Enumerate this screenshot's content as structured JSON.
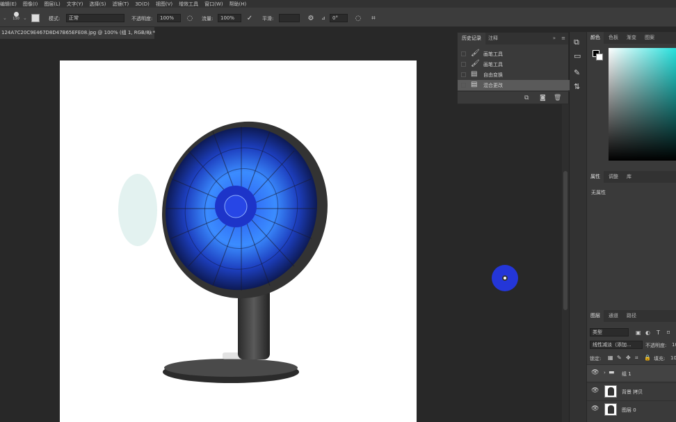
{
  "menu": [
    "编辑(E)",
    "图像(I)",
    "图层(L)",
    "文字(Y)",
    "选择(S)",
    "滤镜(T)",
    "3D(D)",
    "视图(V)",
    "增效工具",
    "窗口(W)",
    "帮助(H)"
  ],
  "options": {
    "brush_size": "130",
    "mode_label": "模式:",
    "mode_value": "正常",
    "opacity_label": "不透明度:",
    "opacity_value": "100%",
    "flow_label": "流量:",
    "flow_value": "100%",
    "smoothing_label": "平滑:",
    "angle_value": "0°"
  },
  "document": {
    "tab_title": "124A7C20C9E467D8D47B65EFE08.jpg @ 100% (组 1, RGB/8) *",
    "close": "×"
  },
  "history_panel": {
    "tabs": [
      "历史记录",
      "注释"
    ],
    "items": [
      {
        "icon": "brush-icon",
        "glyph": "🖌",
        "label": "画笔工具",
        "selected": false
      },
      {
        "icon": "brush-icon",
        "glyph": "🖌",
        "label": "画笔工具",
        "selected": false
      },
      {
        "icon": "document-icon",
        "glyph": "▤",
        "label": "自由变换",
        "selected": false
      },
      {
        "icon": "document-icon",
        "glyph": "▤",
        "label": "混合更改",
        "selected": true
      }
    ]
  },
  "color_panel": {
    "tabs": [
      "颜色",
      "色板",
      "渐变",
      "图案"
    ],
    "hue_color": "#27e1dd",
    "foreground": "#000000",
    "background": "#ffffff"
  },
  "properties_panel": {
    "tabs": [
      "属性",
      "调整",
      "库"
    ],
    "empty_text": "无属性"
  },
  "layers_panel": {
    "tabs": [
      "图层",
      "通道",
      "路径"
    ],
    "filter_value": "类型",
    "blend_mode": "线性减淡（添加...",
    "opacity_label": "不透明度:",
    "opacity_value": "10",
    "lock_label": "锁定:",
    "fill_label": "填充:",
    "fill_value": "10",
    "layers": [
      {
        "name": "组 1",
        "type": "group"
      },
      {
        "name": "背景 拷贝",
        "type": "layer"
      },
      {
        "name": "图层 0",
        "type": "layer"
      }
    ]
  },
  "colors": {
    "app_bg": "#282828",
    "panel_bg": "#3a3a3a",
    "cursor_blue": "#2436d8"
  }
}
